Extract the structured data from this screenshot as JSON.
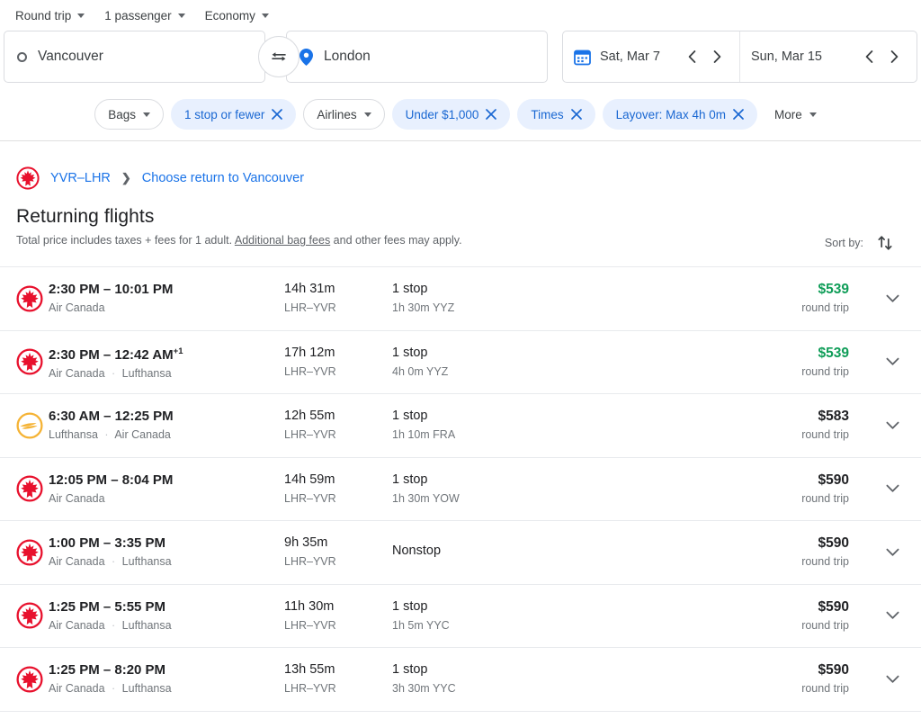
{
  "options": [
    {
      "label": "Round trip",
      "name": "trip-type"
    },
    {
      "label": "1 passenger",
      "name": "passengers"
    },
    {
      "label": "Economy",
      "name": "cabin-class"
    }
  ],
  "search": {
    "origin": "Vancouver",
    "destination": "London",
    "depart_date": "Sat, Mar 7",
    "return_date": "Sun, Mar 15"
  },
  "filters": [
    {
      "label": "Bags",
      "type": "dropdown",
      "active": false
    },
    {
      "label": "1 stop or fewer",
      "type": "clear",
      "active": true
    },
    {
      "label": "Airlines",
      "type": "dropdown",
      "active": false
    },
    {
      "label": "Under $1,000",
      "type": "clear",
      "active": true
    },
    {
      "label": "Times",
      "type": "clear",
      "active": true
    },
    {
      "label": "Layover: Max 4h 0m",
      "type": "clear",
      "active": true
    },
    {
      "label": "More",
      "type": "plain",
      "active": false
    }
  ],
  "breadcrumb": {
    "leg": "YVR–LHR",
    "current": "Choose return to Vancouver"
  },
  "heading": {
    "title": "Returning flights",
    "note_before": "Total price includes taxes + fees for 1 adult. ",
    "note_link": "Additional bag fees",
    "note_after": " and other fees may apply.",
    "sort_label": "Sort by:"
  },
  "flights": [
    {
      "airline_logo": "air-canada",
      "times": "2:30 PM – 10:01 PM",
      "plus_days": "",
      "carriers": "Air Canada",
      "duration": "14h 31m",
      "route": "LHR–YVR",
      "stops": "1 stop",
      "layover": "1h 30m YYZ",
      "price": "$539",
      "price_note": "round trip",
      "is_deal": true
    },
    {
      "airline_logo": "air-canada",
      "times": "2:30 PM – 12:42 AM",
      "plus_days": "+1",
      "carriers": "Air Canada · Lufthansa",
      "duration": "17h 12m",
      "route": "LHR–YVR",
      "stops": "1 stop",
      "layover": "4h 0m YYZ",
      "price": "$539",
      "price_note": "round trip",
      "is_deal": true
    },
    {
      "airline_logo": "lufthansa",
      "times": "6:30 AM – 12:25 PM",
      "plus_days": "",
      "carriers": "Lufthansa · Air Canada",
      "duration": "12h 55m",
      "route": "LHR–YVR",
      "stops": "1 stop",
      "layover": "1h 10m FRA",
      "price": "$583",
      "price_note": "round trip",
      "is_deal": false
    },
    {
      "airline_logo": "air-canada",
      "times": "12:05 PM – 8:04 PM",
      "plus_days": "",
      "carriers": "Air Canada",
      "duration": "14h 59m",
      "route": "LHR–YVR",
      "stops": "1 stop",
      "layover": "1h 30m YOW",
      "price": "$590",
      "price_note": "round trip",
      "is_deal": false
    },
    {
      "airline_logo": "air-canada",
      "times": "1:00 PM – 3:35 PM",
      "plus_days": "",
      "carriers": "Air Canada · Lufthansa",
      "duration": "9h 35m",
      "route": "LHR–YVR",
      "stops": "Nonstop",
      "layover": "",
      "price": "$590",
      "price_note": "round trip",
      "is_deal": false
    },
    {
      "airline_logo": "air-canada",
      "times": "1:25 PM – 5:55 PM",
      "plus_days": "",
      "carriers": "Air Canada · Lufthansa",
      "duration": "11h 30m",
      "route": "LHR–YVR",
      "stops": "1 stop",
      "layover": "1h 5m YYC",
      "price": "$590",
      "price_note": "round trip",
      "is_deal": false
    },
    {
      "airline_logo": "air-canada",
      "times": "1:25 PM – 8:20 PM",
      "plus_days": "",
      "carriers": "Air Canada · Lufthansa",
      "duration": "13h 55m",
      "route": "LHR–YVR",
      "stops": "1 stop",
      "layover": "3h 30m YYC",
      "price": "$590",
      "price_note": "round trip",
      "is_deal": false
    }
  ],
  "colors": {
    "accent": "#1a73e8",
    "chip_active_bg": "#e8f0fe",
    "chip_active_text": "#1967d2",
    "deal_green": "#0f9d58",
    "air_canada_red": "#e8112d",
    "lufthansa_gold": "#f5b335"
  }
}
